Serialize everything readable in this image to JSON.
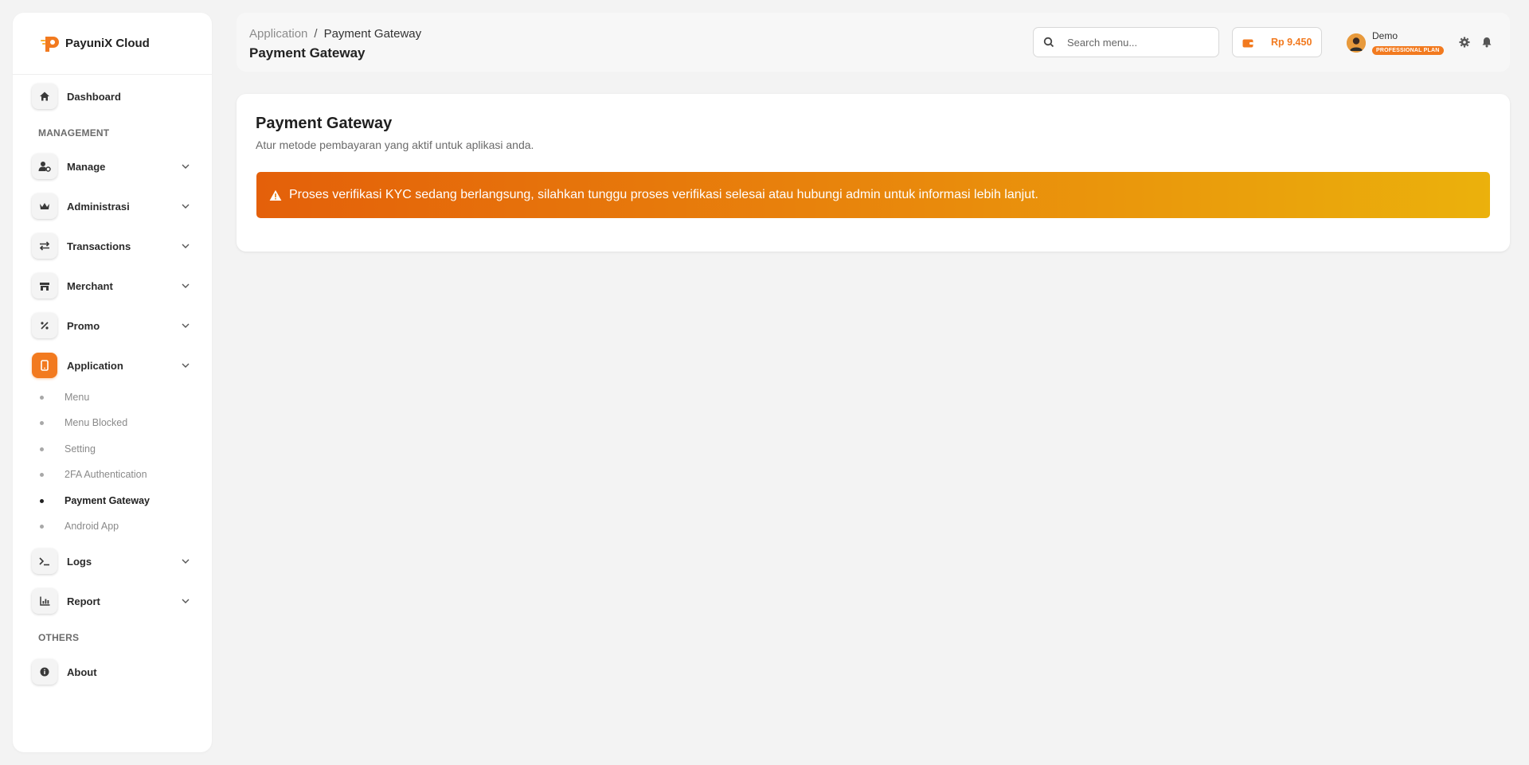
{
  "brand": {
    "name": "PayuniX Cloud"
  },
  "sidebar": {
    "dashboard_label": "Dashboard",
    "section_management": "MANAGEMENT",
    "items": [
      {
        "label": "Manage",
        "icon": "user-gear-icon"
      },
      {
        "label": "Administrasi",
        "icon": "crown-icon"
      },
      {
        "label": "Transactions",
        "icon": "exchange-icon"
      },
      {
        "label": "Merchant",
        "icon": "store-icon"
      },
      {
        "label": "Promo",
        "icon": "percent-icon"
      },
      {
        "label": "Application",
        "icon": "mobile-icon",
        "active": true
      }
    ],
    "application_sub": [
      {
        "label": "Menu"
      },
      {
        "label": "Menu Blocked"
      },
      {
        "label": "Setting"
      },
      {
        "label": "2FA Authentication"
      },
      {
        "label": "Payment Gateway",
        "active": true
      },
      {
        "label": "Android App"
      }
    ],
    "logs_label": "Logs",
    "report_label": "Report",
    "section_others": "OTHERS",
    "about_label": "About"
  },
  "header": {
    "breadcrumb_parent": "Application",
    "breadcrumb_sep": "/",
    "breadcrumb_current": "Payment Gateway",
    "page_title": "Payment Gateway",
    "search_placeholder": "Search menu...",
    "balance": "Rp 9.450",
    "user_name": "Demo",
    "plan": "PROFESSIONAL PLAN"
  },
  "main": {
    "title": "Payment Gateway",
    "subtitle": "Atur metode pembayaran yang aktif untuk aplikasi anda.",
    "alert": "Proses verifikasi KYC sedang berlangsung, silahkan tunggu proses verifikasi selesai atau hubungi admin untuk informasi lebih lanjut."
  },
  "colors": {
    "accent": "#f27a1f",
    "alert_start": "#e4600a",
    "alert_end": "#ebb10c"
  }
}
